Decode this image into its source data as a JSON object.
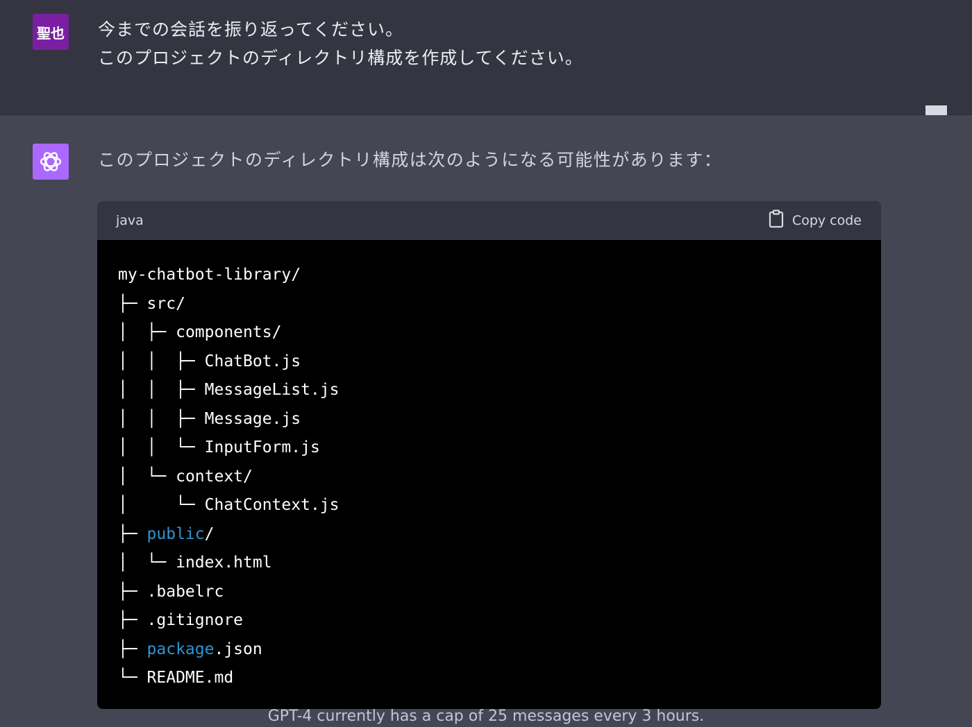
{
  "user": {
    "avatar_label": "聖也",
    "message_lines": [
      "今までの会話を振り返ってください。",
      "このプロジェクトのディレクトリ構成を作成してください。"
    ]
  },
  "assistant": {
    "message": "このプロジェクトのディレクトリ構成は次のようになる可能性があります：",
    "code_block": {
      "language": "java",
      "copy_label": "Copy code",
      "lines": [
        {
          "prefix": "",
          "name": "my-chatbot-library/"
        },
        {
          "prefix": "├─ ",
          "name": "src/"
        },
        {
          "prefix": "│  ├─ ",
          "name": "components/"
        },
        {
          "prefix": "│  │  ├─ ",
          "name": "ChatBot.js"
        },
        {
          "prefix": "│  │  ├─ ",
          "name": "MessageList.js"
        },
        {
          "prefix": "│  │  ├─ ",
          "name": "Message.js"
        },
        {
          "prefix": "│  │  └─ ",
          "name": "InputForm.js"
        },
        {
          "prefix": "│  └─ ",
          "name": "context/"
        },
        {
          "prefix": "│     └─ ",
          "name": "ChatContext.js"
        },
        {
          "prefix": "├─ ",
          "name": "public/",
          "highlight": "public"
        },
        {
          "prefix": "│  └─ ",
          "name": "index.html"
        },
        {
          "prefix": "├─ ",
          "name": ".babelrc"
        },
        {
          "prefix": "├─ ",
          "name": ".gitignore"
        },
        {
          "prefix": "├─ ",
          "name": "package.json",
          "highlight": "package"
        },
        {
          "prefix": "└─ ",
          "name": "README.md"
        }
      ]
    }
  },
  "icons": [
    "bookmark-icon",
    "thumbs-up-icon",
    "thumbs-down-icon",
    "clipboard-icon",
    "openai-logo-icon"
  ],
  "footer_note": "GPT-4 currently has a cap of 25 messages every 3 hours.",
  "colors": {
    "user_bg": "#343541",
    "assistant_bg": "#444654",
    "user_avatar": "#7a1fa2",
    "bot_avatar": "#ab68ff",
    "keyword": "#2e95d3"
  }
}
